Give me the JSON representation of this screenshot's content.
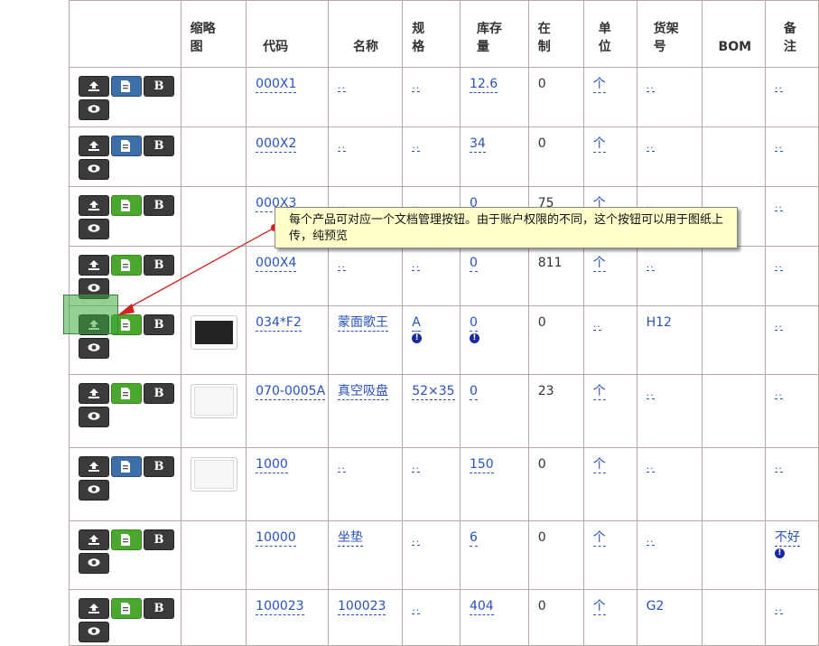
{
  "headers": {
    "thumbnail": "缩略图",
    "code": "代码",
    "name": "名称",
    "spec": "规格",
    "stock": "库存量",
    "in_production": "在制",
    "unit": "单位",
    "shelf": "货架号",
    "bom": "BOM",
    "remark": "备注"
  },
  "buttons": {
    "bom_label": "B"
  },
  "callout": {
    "text": "每个产品可对应一个文档管理按钮。由于账户权限的不同，这个按钮可以用于图纸上传，纯预览"
  },
  "colors": {
    "doc_blue": "#3c6fa8",
    "doc_green": "#4aa82c",
    "dark": "#3b3b3b",
    "link": "#2a52be",
    "callout_bg": "#ffffcc",
    "arrow": "#d22222"
  },
  "rows": [
    {
      "doc": "blue",
      "thumb": "",
      "code": "000X1",
      "name": "..",
      "spec": "..",
      "stock": "12.6",
      "wip": "0",
      "unit": "个",
      "shelf": "..",
      "remark": ".."
    },
    {
      "doc": "blue",
      "thumb": "",
      "code": "000X2",
      "name": "..",
      "spec": "..",
      "stock": "34",
      "wip": "0",
      "unit": "个",
      "shelf": "..",
      "remark": ".."
    },
    {
      "doc": "green",
      "thumb": "",
      "code": "000X3",
      "name": "..",
      "spec": "..",
      "stock": "0",
      "wip": "75",
      "unit": "个",
      "shelf": "..",
      "remark": ".."
    },
    {
      "doc": "green",
      "thumb": "",
      "code": "000X4",
      "name": "..",
      "spec": "..",
      "stock": "0",
      "wip": "811",
      "unit": "个",
      "shelf": "..",
      "remark": ".."
    },
    {
      "doc": "green",
      "thumb": "dark",
      "code": "034*F2",
      "name": "蒙面歌王",
      "spec": "A",
      "stock": "0",
      "wip": "0",
      "unit": "..",
      "shelf": "H12",
      "remark": ".."
    },
    {
      "doc": "green",
      "thumb": "drawing",
      "code": "070-0005A",
      "name": "真空吸盘",
      "spec": "52×35",
      "stock": "0",
      "wip": "23",
      "unit": "个",
      "shelf": "..",
      "remark": ".."
    },
    {
      "doc": "blue",
      "thumb": "drawing",
      "code": "1000",
      "name": "..",
      "spec": "..",
      "stock": "150",
      "wip": "0",
      "unit": "个",
      "shelf": "..",
      "remark": ".."
    },
    {
      "doc": "green",
      "thumb": "",
      "code": "10000",
      "name": "坐垫",
      "spec": "..",
      "stock": "6",
      "wip": "0",
      "unit": "个",
      "shelf": "..",
      "remark": "不好"
    },
    {
      "doc": "green",
      "thumb": "",
      "code": "100023",
      "name": "100023",
      "spec": "..",
      "stock": "404",
      "wip": "0",
      "unit": "个",
      "shelf": "G2",
      "remark": ".."
    }
  ]
}
